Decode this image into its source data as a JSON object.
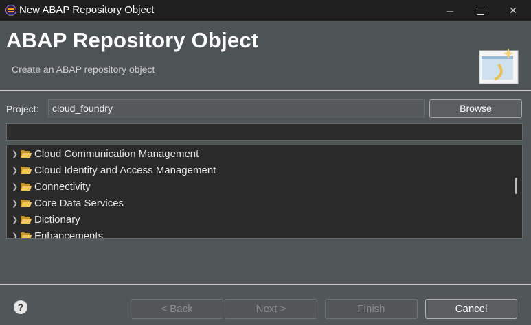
{
  "window": {
    "title": "New ABAP Repository Object"
  },
  "banner": {
    "title": "ABAP Repository Object",
    "subtitle": "Create an ABAP repository object"
  },
  "project": {
    "label": "Project:",
    "value": "cloud_foundry",
    "browse_label": "Browse"
  },
  "filter": {
    "value": ""
  },
  "tree": {
    "items": [
      {
        "label": "Cloud Communication Management",
        "icon": "folder-icon"
      },
      {
        "label": "Cloud Identity and Access Management",
        "icon": "folder-icon"
      },
      {
        "label": "Connectivity",
        "icon": "folder-icon"
      },
      {
        "label": "Core Data Services",
        "icon": "folder-icon"
      },
      {
        "label": "Dictionary",
        "icon": "folder-icon"
      },
      {
        "label": "Enhancements",
        "icon": "folder-icon"
      }
    ]
  },
  "footer": {
    "help": "?",
    "back_label": "< Back",
    "next_label": "Next >",
    "finish_label": "Finish",
    "cancel_label": "Cancel"
  },
  "colors": {
    "titlebar": "#1f1f1f",
    "dialog_bg": "#515658",
    "tree_bg": "#2a2a2a",
    "folder": "#f2c65a"
  }
}
